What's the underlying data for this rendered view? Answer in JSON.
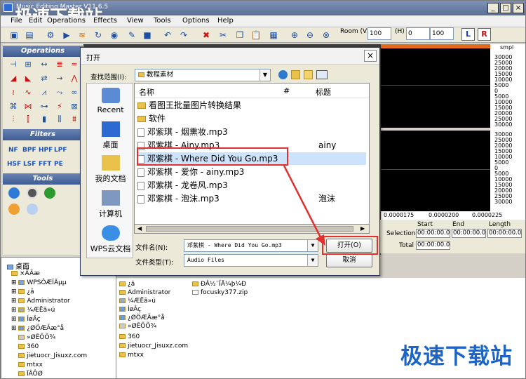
{
  "app": {
    "title": "Music Editing Master V11.6.5",
    "watermark_top": "极速下载站",
    "menus": [
      "File",
      "Edit",
      "Operations",
      "Effects",
      "View",
      "Tools",
      "Options",
      "Help"
    ],
    "room_label": "Room (V)",
    "room_value": "100",
    "h_label": "(H)",
    "h_value1": "0",
    "h_value2": "100",
    "left_btn": "L",
    "right_btn": "R",
    "sections": {
      "operations": "Operations",
      "filters": "Filters",
      "tools": "Tools"
    },
    "filters_row1": [
      "NF",
      "BPF",
      "HPF",
      "LPF"
    ],
    "filters_row2": [
      "HSF",
      "LSF",
      "FFT",
      "PE"
    ],
    "scale_unit": "smpl",
    "scale_top": [
      "30000",
      "25000",
      "20000",
      "15000",
      "10000",
      "5000",
      "0",
      "5000",
      "10000",
      "15000",
      "20000",
      "25000",
      "30000"
    ],
    "scale_bottom": [
      "30000",
      "25000",
      "20000",
      "15000",
      "10000",
      "5000",
      "0",
      "5000",
      "10000",
      "15000",
      "20000",
      "25000",
      "30000"
    ],
    "time_axis": [
      "0.0000175",
      "0.0000200",
      "0.0000225"
    ],
    "time_headers": [
      "Start",
      "End",
      "Length"
    ],
    "selection_label": "Selection",
    "selection_values": [
      "00:00:00.0",
      "00:00:00.0",
      "00:00:00.0"
    ],
    "total_label": "Total",
    "total_value": "00:00:00.0",
    "tree": [
      {
        "label": "桌面"
      },
      {
        "label": "×ÃÃæ"
      },
      {
        "label": "WPSÔÆÎÄµµ"
      },
      {
        "label": "¿â"
      },
      {
        "label": "Administrator"
      },
      {
        "label": "¼ÆËã»ú"
      },
      {
        "label": "ÍøÂç"
      },
      {
        "label": "¿ØÖÆÃæ°å"
      },
      {
        "label": "»ØÊÕÕ¾"
      },
      {
        "label": "360"
      },
      {
        "label": "jietuocr_Jisuxz.com"
      },
      {
        "label": "mtxx"
      },
      {
        "label": "ÏÂÔØ"
      },
      {
        "label": "ÐÂ½¨ÎÄ¼þ¼Ð"
      }
    ],
    "files_col1": [
      "¿â",
      "Administrator",
      "¼ÆËã»ú",
      "ÍøÂç",
      "¿ØÖÆÃæ°å",
      "»ØÊÕÕ¾",
      "360",
      "jietuocr_Jisuxz.com",
      "mtxx"
    ],
    "files_col2": [
      "ÐÂ½¨ÎÄ¼þ¼Ð",
      "focusky377.zip"
    ],
    "watermark": "极速下载站"
  },
  "dialog": {
    "title": "打开",
    "lookin_label": "查找范围(I):",
    "lookin_value": "教程素材",
    "places": [
      "Recent",
      "桌面",
      "我的文档",
      "计算机",
      "WPS云文档"
    ],
    "columns": [
      "名称",
      "#",
      "标题"
    ],
    "rows": [
      {
        "name": "看图王批量图片转换结果",
        "tag": ""
      },
      {
        "name": "软件",
        "tag": ""
      },
      {
        "name": "邓紫琪 - 烟熏妆.mp3",
        "tag": ""
      },
      {
        "name": "邓紫棋 - Ainy.mp3",
        "tag": "ainy"
      },
      {
        "name": "邓紫棋 - Where Did You Go.mp3",
        "tag": ""
      },
      {
        "name": "邓紫棋 - 爱你 - ainy.mp3",
        "tag": ""
      },
      {
        "name": "邓紫棋 - 龙卷风.mp3",
        "tag": ""
      },
      {
        "name": "邓紫棋 - 泡沫.mp3",
        "tag": "泡沫"
      }
    ],
    "filename_label": "文件名(N):",
    "filename_value": "邓紫棋 - Where Did You Go.mp3",
    "filetype_label": "文件类型(T):",
    "filetype_value": "Audio Files",
    "open_label": "打开(O)",
    "cancel_label": "取消"
  }
}
